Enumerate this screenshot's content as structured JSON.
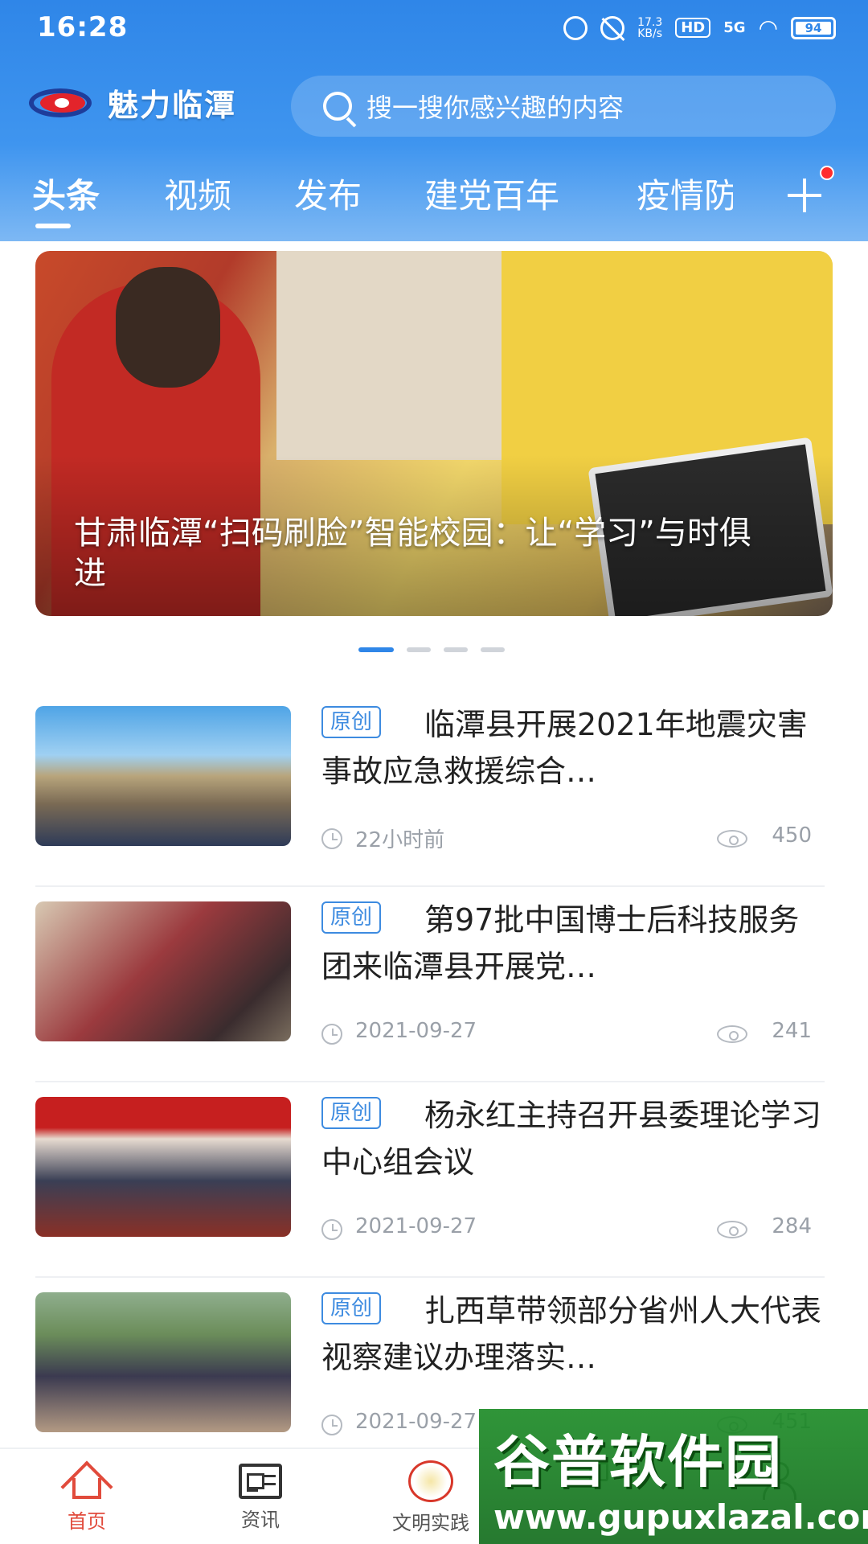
{
  "status_bar": {
    "time": "16:28",
    "net_speed_value": "17.3",
    "net_speed_unit": "KB/s",
    "hd": "HD",
    "signal": "5G",
    "battery": "94"
  },
  "header": {
    "brand_name": "魅力临潭",
    "search_placeholder": "搜一搜你感兴趣的内容"
  },
  "tabs": [
    {
      "label": "头条",
      "active": true
    },
    {
      "label": "视频"
    },
    {
      "label": "发布"
    },
    {
      "label": "建党百年"
    },
    {
      "label": "疫情防"
    }
  ],
  "banner": {
    "title": "甘肃临潭“扫码刷脸”智能校园：让“学习”与时俱进",
    "page_count": 4,
    "current_page": 1
  },
  "news": [
    {
      "badge": "原创",
      "title": "临潭县开展2021年地震灾害事故应急救援综合…",
      "time": "22小时前",
      "views": "450"
    },
    {
      "badge": "原创",
      "title": "第97批中国博士后科技服务团来临潭县开展党…",
      "time": "2021-09-27",
      "views": "241"
    },
    {
      "badge": "原创",
      "title": "杨永红主持召开县委理论学习中心组会议",
      "time": "2021-09-27",
      "views": "284"
    },
    {
      "badge": "原创",
      "title": "扎西草带领部分省州人大代表视察建议办理落实…",
      "time": "2021-09-27",
      "views": "451"
    }
  ],
  "bottom_nav": [
    {
      "label": "首页",
      "icon": "home-icon",
      "active": true
    },
    {
      "label": "资讯",
      "icon": "news-icon"
    },
    {
      "label": "文明实践",
      "icon": "civilization-practice-icon"
    },
    {
      "label": "",
      "icon": "grid-icon"
    },
    {
      "label": "",
      "icon": "user-icon"
    }
  ],
  "watermark": {
    "main": "谷普软件园",
    "url": "www.gupuxlazal.com"
  },
  "colors": {
    "header_blue": "#2f86e8",
    "accent_red": "#e14b3c",
    "badge_blue": "#3d8be0"
  }
}
